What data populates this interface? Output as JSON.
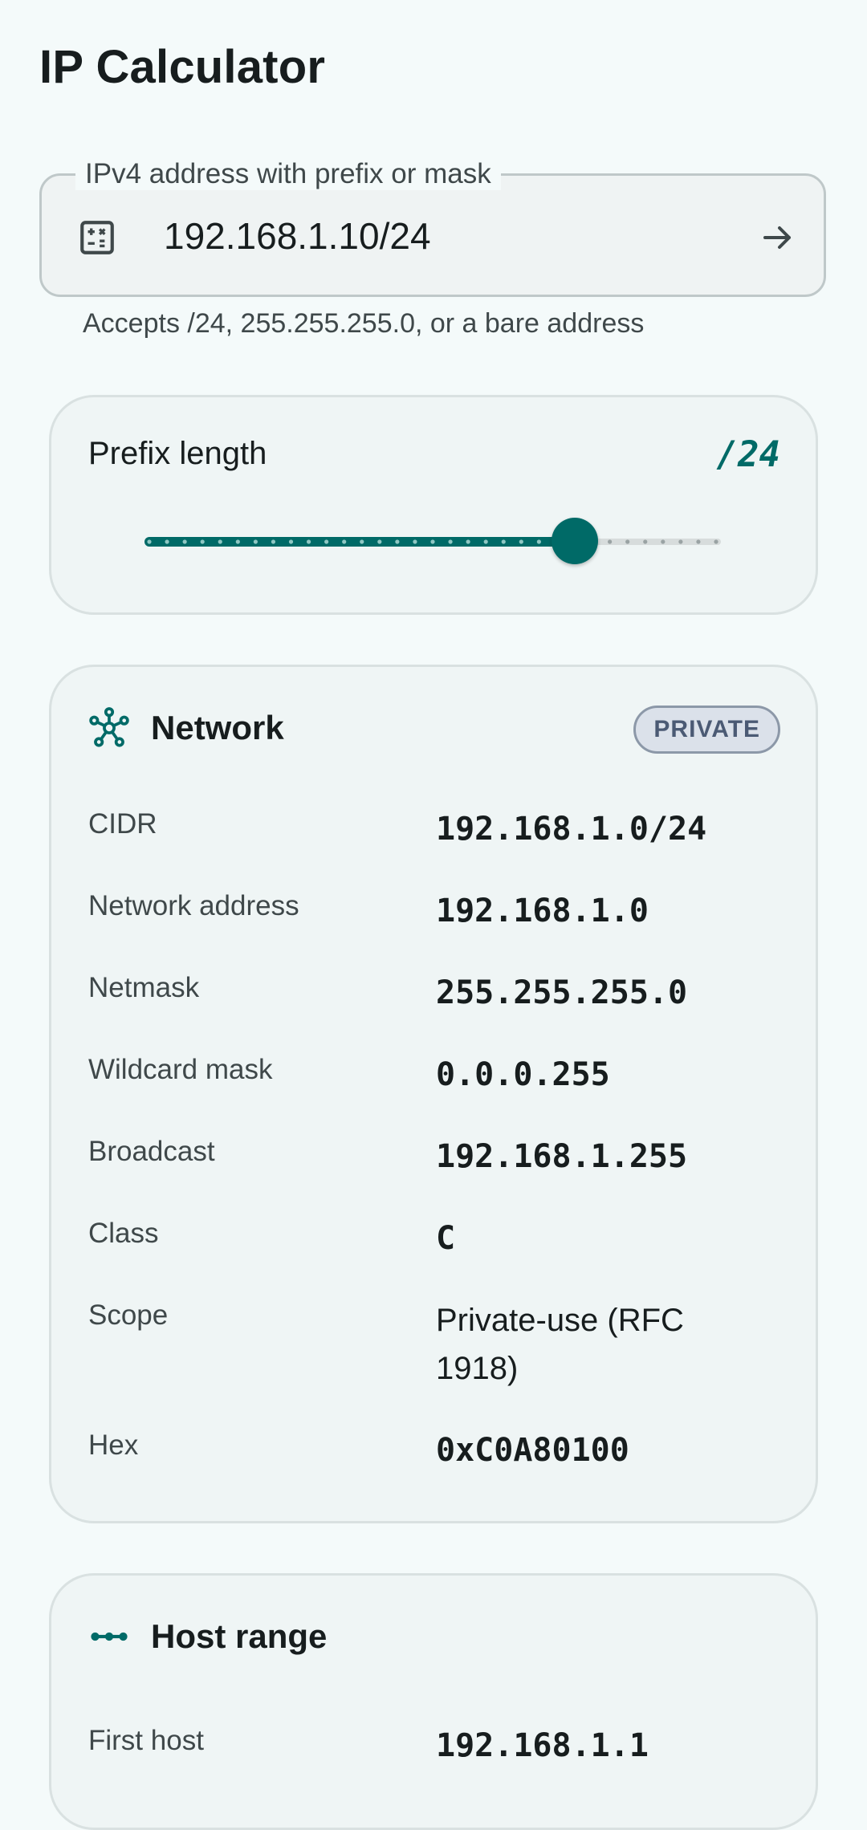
{
  "app": {
    "title": "IP Calculator"
  },
  "input": {
    "label": "IPv4 address with prefix or mask",
    "value": "192.168.1.10/24",
    "helper": "Accepts /24, 255.255.255.0, or a bare address",
    "leading_icon": "calculator-icon",
    "trailing_icon": "arrow-forward-icon"
  },
  "prefix": {
    "label": "Prefix length",
    "display": "/24",
    "value": 24,
    "min": 0,
    "max": 32
  },
  "network": {
    "icon": "hub-icon",
    "title": "Network",
    "badge": "PRIVATE",
    "rows": [
      {
        "key": "CIDR",
        "value": "192.168.1.0/24"
      },
      {
        "key": "Network address",
        "value": "192.168.1.0"
      },
      {
        "key": "Netmask",
        "value": "255.255.255.0"
      },
      {
        "key": "Wildcard mask",
        "value": "0.0.0.255"
      },
      {
        "key": "Broadcast",
        "value": "192.168.1.255"
      },
      {
        "key": "Class",
        "value": "C"
      },
      {
        "key": "Scope",
        "value": "Private-use (RFC 1918)"
      },
      {
        "key": "Hex",
        "value": "0xC0A80100"
      }
    ]
  },
  "host_range": {
    "icon": "linear-scale-icon",
    "title": "Host range",
    "rows": [
      {
        "key": "First host",
        "value": "192.168.1.1"
      }
    ]
  },
  "colors": {
    "accent": "#006a67",
    "background": "#f4fafa",
    "badge_bg": "#dbe1ea",
    "badge_text": "#4b5a74"
  }
}
